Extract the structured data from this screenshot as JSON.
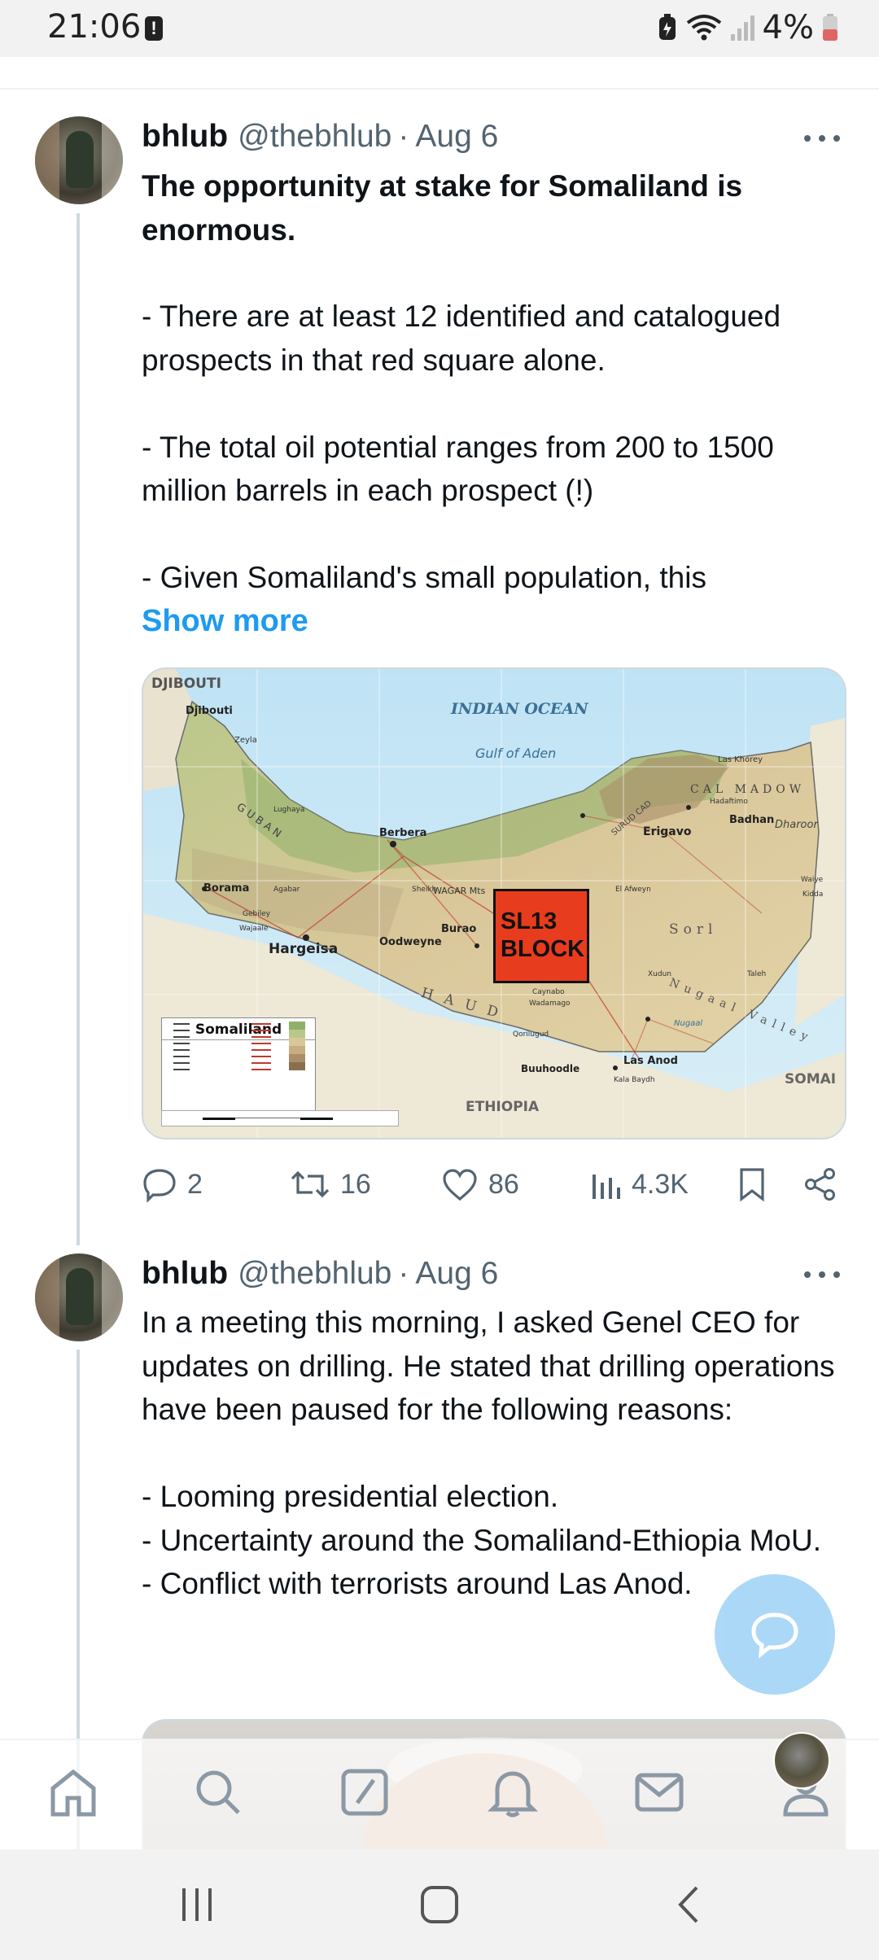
{
  "status_bar": {
    "time": "21:06",
    "battery_percent": "4%",
    "icons": [
      "alert-icon",
      "battery-saver-icon",
      "wifi-icon",
      "signal-icon",
      "battery-icon"
    ]
  },
  "tweets": [
    {
      "display_name": "bhlub",
      "handle": "@thebhlub",
      "separator": "·",
      "date": "Aug 6",
      "headline": "The opportunity at stake for Somaliland is enormous.",
      "body": "- There are at least 12 identified and catalogued prospects in that red square alone.\n\n- The total oil potential ranges from 200 to 1500 million barrels in each prospect (!)\n\n- Given Somaliland's small population, this",
      "show_more": "Show more",
      "media": {
        "map_labels": {
          "djibouti_region": "DJIBOUTI",
          "djibouti_city": "Djibouti",
          "zeyla": "Zeyla",
          "ocean": "INDIAN OCEAN",
          "gulf": "Gulf of Aden",
          "las_khorey": "Las Khorey",
          "cal_madow": "CAL MADOW",
          "hadaftimo": "Hadaftimo",
          "badhan": "Badhan",
          "dharoor": "Dharoor",
          "erigavo": "Erigavo",
          "surud_cad": "SURUD CAD",
          "guban": "GUBAN",
          "lughaya": "Lughaya",
          "berbera": "Berbera",
          "borama": "Borama",
          "agabar": "Agabar",
          "gebiley": "Gebiley",
          "wajaale": "Wajaale",
          "hargeisa": "Hargeisa",
          "sheikh": "Sheikh",
          "wagar_mts": "WAGAR Mts",
          "burao": "Burao",
          "oodweyne": "Oodweyne",
          "el_afweyn": "El Afweyn",
          "sorl": "Sorl",
          "haud": "HAUD",
          "caynabo": "Caynabo",
          "wadamago": "Wadamago",
          "qorilugud": "Qorilugud",
          "nugaal_valley": "Nugaal Valley",
          "nugaal": "Nugaal",
          "xudun": "Xudun",
          "taleh": "Taleh",
          "las_anod": "Las Anod",
          "kala_baydh": "Kala Baydh",
          "buuhoodle": "Buuhoodle",
          "ethiopia": "ETHIOPIA",
          "somalia_partial": "SOMAI",
          "waiye": "Waiye",
          "kidda": "Kidda",
          "legend_title": "Somaliland"
        },
        "block_label_line1": "SL13",
        "block_label_line2": "BLOCK",
        "block_color": "#e83c1e"
      },
      "stats": {
        "replies": "2",
        "reposts": "16",
        "likes": "86",
        "views": "4.3K"
      }
    },
    {
      "display_name": "bhlub",
      "handle": "@thebhlub",
      "separator": "·",
      "date": "Aug 6",
      "body": "In a meeting this morning, I asked Genel CEO for updates on drilling. He stated that drilling operations have been paused for the following reasons:\n\n- Looming presidential election.\n- Uncertainty around the Somaliland-Ethiopia MoU.\n- Conflict with terrorists around Las Anod."
    }
  ],
  "bottom_nav": [
    "home-icon",
    "search-icon",
    "grok-icon",
    "notifications-icon",
    "messages-icon",
    "communities-icon"
  ],
  "system_nav": [
    "recents-icon",
    "home-button-icon",
    "back-icon"
  ],
  "colors": {
    "accent": "#1d9bf0",
    "secondary_text": "#536471",
    "primary_text": "#0f1419",
    "fab": "#a6d5f7"
  }
}
